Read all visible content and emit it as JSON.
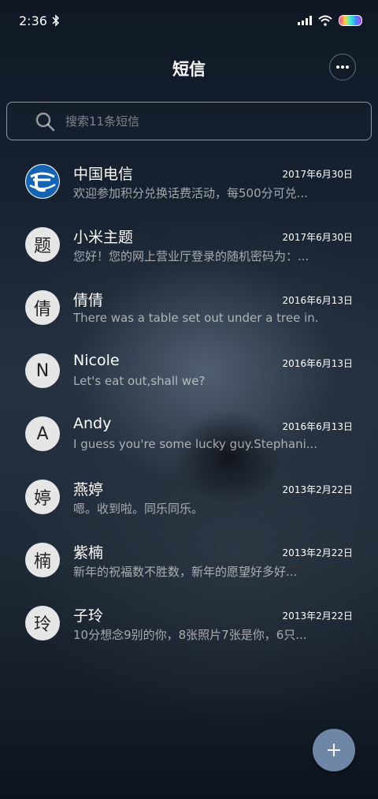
{
  "status_bar": {
    "time": "2:36"
  },
  "header": {
    "title": "短信"
  },
  "search": {
    "placeholder": "搜索11条短信"
  },
  "conversations": [
    {
      "name": "中国电信",
      "avatar": "",
      "date": "2017年6月30日",
      "preview": "欢迎参加积分兑换话费活动，每500分可兑..."
    },
    {
      "name": "小米主题",
      "avatar": "题",
      "date": "2017年6月30日",
      "preview": "您好！您的网上营业厅登录的随机密码为：..."
    },
    {
      "name": "倩倩",
      "avatar": "倩",
      "date": "2016年6月13日",
      "preview": "There was a table set out under a tree in..."
    },
    {
      "name": "Nicole",
      "avatar": "N",
      "date": "2016年6月13日",
      "preview": "Let's eat out,shall we?"
    },
    {
      "name": "Andy",
      "avatar": "A",
      "date": "2016年6月13日",
      "preview": "I guess you're some lucky guy.Stephani..."
    },
    {
      "name": "燕婷",
      "avatar": "婷",
      "date": "2013年2月22日",
      "preview": "嗯。收到啦。同乐同乐。"
    },
    {
      "name": "紫楠",
      "avatar": "楠",
      "date": "2013年2月22日",
      "preview": "新年的祝福数不胜数，新年的愿望好多好..."
    },
    {
      "name": "子玲",
      "avatar": "玲",
      "date": "2013年2月22日",
      "preview": "10分想念9别的你，8张照片7张是你，6只..."
    }
  ],
  "colors": {
    "fab": "#6f87a6",
    "logo_blue": "#1463b4"
  },
  "icons": {
    "bluetooth": "bluetooth-icon",
    "signal": "signal-icon",
    "wifi": "wifi-icon",
    "battery": "battery-icon",
    "more": "more-dots-icon",
    "search": "search-icon",
    "compose": "plus-icon"
  }
}
